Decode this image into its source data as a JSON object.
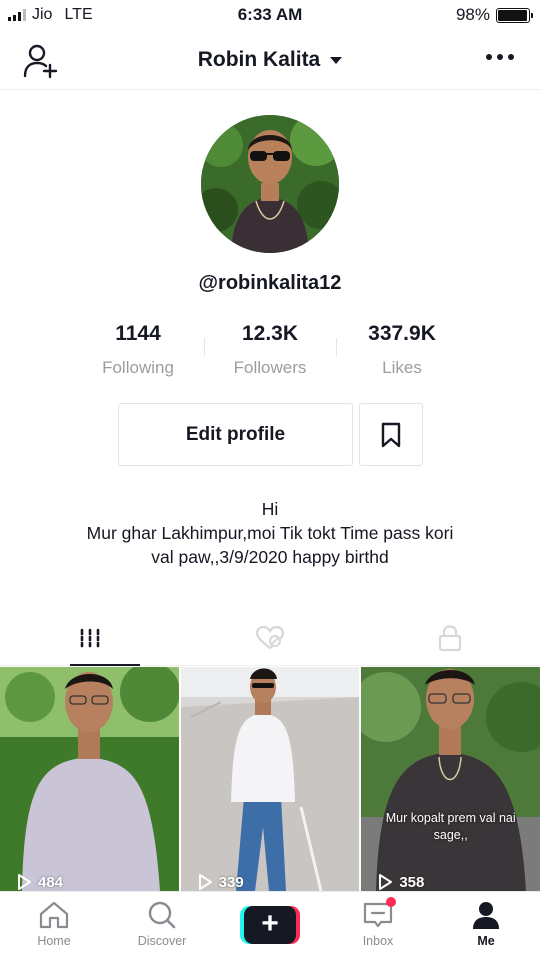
{
  "status_bar": {
    "carrier": "Jio",
    "network": "LTE",
    "time": "6:33 AM",
    "battery": "98%",
    "battery_level": 0.98
  },
  "header": {
    "title": "Robin Kalita",
    "add_user_icon": "person-plus-icon",
    "more_icon": "more-horizontal-icon"
  },
  "profile": {
    "handle": "@robinkalita12",
    "stats": [
      {
        "value": "1144",
        "label": "Following"
      },
      {
        "value": "12.3K",
        "label": "Followers"
      },
      {
        "value": "337.9K",
        "label": "Likes"
      }
    ],
    "edit_button": "Edit profile",
    "bookmark_icon": "bookmark-icon",
    "bio": [
      "Hi",
      "Mur ghar Lakhimpur,moi Tik tokt Time pass kori",
      "val paw,,3/9/2020 happy birthd"
    ]
  },
  "tabs": [
    {
      "icon": "grid-videos-icon",
      "active": true
    },
    {
      "icon": "liked-hidden-icon",
      "active": false
    },
    {
      "icon": "lock-icon",
      "active": false
    }
  ],
  "videos": [
    {
      "views": "484",
      "caption": ""
    },
    {
      "views": "339",
      "caption": ""
    },
    {
      "views": "358",
      "caption": "Mur kopalt prem val nai sage,,"
    }
  ],
  "nav": [
    {
      "label": "Home",
      "icon": "home-icon"
    },
    {
      "label": "Discover",
      "icon": "search-icon"
    },
    {
      "label": "",
      "icon": "create-plus-icon"
    },
    {
      "label": "Inbox",
      "icon": "inbox-icon"
    },
    {
      "label": "Me",
      "icon": "person-icon"
    }
  ],
  "colors": {
    "accent_red": "#fe2c55",
    "accent_cyan": "#25f4ee",
    "text_primary": "#161823",
    "text_secondary": "#9b9ca2"
  }
}
